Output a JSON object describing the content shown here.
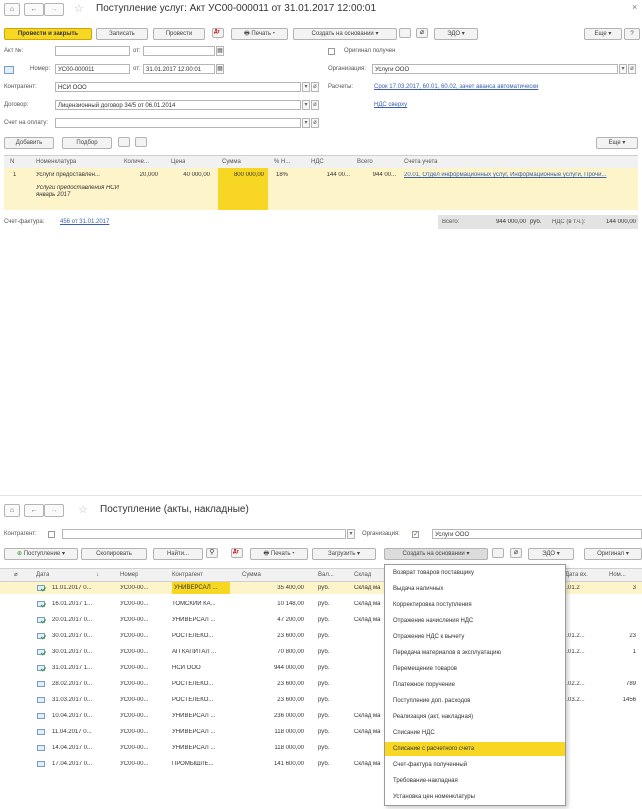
{
  "top": {
    "title": "Поступление услуг: Акт УС00-000011 от 31.01.2017 12:00:01",
    "close": "×",
    "toolbar": {
      "post_close": "Провести и закрыть",
      "save": "Записать",
      "post": "Провести",
      "print": "Печать",
      "create_basis": "Создать на основании",
      "edo": "ЭДО",
      "more": "Еще",
      "help": "?"
    },
    "fields": {
      "act_label": "Акт №:",
      "act_value": "",
      "from1": "от:",
      "date1": ". .",
      "orig_label": "Оригинал получен",
      "number_label": "Номер:",
      "number_value": "УС00-000011",
      "from2": "от:",
      "date2": "31.01.2017 12:00:01",
      "org_label": "Организация:",
      "org_value": "Услуги ООО",
      "counterparty_label": "Контрагент:",
      "counterparty_value": "НСИ ООО",
      "settlements_label": "Расчеты:",
      "settlements_link": "Срок 17.03.2017, 60.01, 60.02, зачет аванса автоматически",
      "contract_label": "Договор:",
      "contract_value": "Лицензионный договор 34/5 от 06.01.2014",
      "vat_link": "НДС сверху",
      "invoice_label": "Счет на оплату:",
      "invoice_value": ""
    },
    "table_toolbar": {
      "add": "Добавить",
      "pick": "Подбор",
      "more": "Еще"
    },
    "columns": [
      "N",
      "Номенклатура",
      "Количе...",
      "Цена",
      "Сумма",
      "% Н...",
      "НДС",
      "Всего",
      "Счета учета"
    ],
    "row": {
      "n": "1",
      "item": "Услуги предоставлен...",
      "item_content": "Услуги предоставления НСИ январь 2017",
      "qty": "20,000",
      "price": "40 000,00",
      "sum": "800 000,00",
      "vat_rate": "18%",
      "vat": "144 00...",
      "total": "944 00...",
      "accounts": "20.01, Отдел информационных услуг, Информационные услуги, Прочи..."
    },
    "footer": {
      "invoice_label": "Счет-фактура:",
      "invoice_link": "456 от 31.01.2017",
      "total_label": "Всего:",
      "total_value": "944 000,00",
      "currency": "руб.",
      "vat_label": "НДС (в т.ч.):",
      "vat_value": "144 000,00"
    }
  },
  "bottom": {
    "title": "Поступление (акты, накладные)",
    "filter": {
      "counterparty_label": "Контрагент:",
      "org_label": "Организация:",
      "org_value": "Услуги ООО"
    },
    "toolbar": {
      "receipt": "Поступление",
      "copy": "Скопировать",
      "find": "Найти...",
      "print": "Печать",
      "load": "Загрузить",
      "create_basis": "Создать на основании",
      "edo": "ЭДО",
      "original": "Оригинал"
    },
    "columns": [
      "Дата",
      "↓",
      "Номер",
      "Контрагент",
      "Сумма",
      "Вал...",
      "Склад",
      "Дата вх.",
      "Ном..."
    ],
    "rows": [
      {
        "date": "11.01.2017 0...",
        "num": "УС00-00...",
        "cp": "УНИВЕРСАЛ ...",
        "sum": "35 400,00",
        "cur": "руб.",
        "wh": "Склад ма",
        "indate": "1.01.2",
        "innum": "3",
        "posted": true
      },
      {
        "date": "16.01.2017 1...",
        "num": "УС00-00...",
        "cp": "ТОМСКИЙ КА...",
        "sum": "10 148,00",
        "cur": "руб.",
        "wh": "Склад ма",
        "indate": "",
        "innum": "",
        "posted": true
      },
      {
        "date": "20.01.2017 0...",
        "num": "УС00-00...",
        "cp": "УНИВЕРСАЛ ...",
        "sum": "47 200,00",
        "cur": "руб.",
        "wh": "Склад ма",
        "indate": "",
        "innum": "",
        "posted": true
      },
      {
        "date": "30.01.2017 0...",
        "num": "УС00-00...",
        "cp": "РОСТЕЛЕКО...",
        "sum": "23 600,00",
        "cur": "руб.",
        "wh": "",
        "indate": "0.01.2...",
        "innum": "23",
        "posted": true
      },
      {
        "date": "30.01.2017 0...",
        "num": "УС00-00...",
        "cp": "АП КАПИТАЛ ...",
        "sum": "70 800,00",
        "cur": "руб.",
        "wh": "",
        "indate": "0.01.2...",
        "innum": "1",
        "posted": true
      },
      {
        "date": "31.01.2017 1...",
        "num": "УС00-00...",
        "cp": "НСИ ООО",
        "sum": "944 000,00",
        "cur": "руб.",
        "wh": "",
        "indate": "",
        "innum": "",
        "posted": true
      },
      {
        "date": "28.02.2017 0...",
        "num": "УС00-00...",
        "cp": "РОСТЕЛЕКО...",
        "sum": "23 600,00",
        "cur": "руб.",
        "wh": "",
        "indate": "8.02.2...",
        "innum": "789",
        "posted": false
      },
      {
        "date": "31.03.2017 0...",
        "num": "УС00-00...",
        "cp": "РОСТЕЛЕКО...",
        "sum": "23 600,00",
        "cur": "руб.",
        "wh": "",
        "indate": "1.03.2...",
        "innum": "1456",
        "posted": false
      },
      {
        "date": "10.04.2017 0...",
        "num": "УС00-00...",
        "cp": "УНИВЕРСАЛ ...",
        "sum": "236 000,00",
        "cur": "руб.",
        "wh": "Склад ма",
        "indate": "",
        "innum": "",
        "posted": false
      },
      {
        "date": "11.04.2017 0...",
        "num": "УС00-00...",
        "cp": "УНИВЕРСАЛ ...",
        "sum": "118 000,00",
        "cur": "руб.",
        "wh": "Склад ма",
        "indate": "",
        "innum": "",
        "posted": false
      },
      {
        "date": "14.04.2017 0...",
        "num": "УС00-00...",
        "cp": "УНИВЕРСАЛ ...",
        "sum": "118 000,00",
        "cur": "руб.",
        "wh": "",
        "indate": "",
        "innum": "",
        "posted": false
      },
      {
        "date": "17.04.2017 0...",
        "num": "УС00-00...",
        "cp": "ПРОМЫШЛЕ...",
        "sum": "141 600,00",
        "cur": "руб.",
        "wh": "Склад ма",
        "indate": "",
        "innum": "",
        "posted": false
      }
    ],
    "menu": [
      "Возврат товаров поставщику",
      "Выдача наличных",
      "Корректировка поступления",
      "Отражение начисления НДС",
      "Отражение НДС к вычету",
      "Передача материалов в эксплуатацию",
      "Перемещение товаров",
      "Платежное поручение",
      "Поступление доп. расходов",
      "Реализация (акт, накладная)",
      "Списание НДС",
      "Списание с расчетного счета",
      "Счет-фактура полученный",
      "Требование-накладная",
      "Установка цен номенклатуры"
    ],
    "menu_selected": 11
  },
  "colors": {
    "accent": "#f7d724",
    "link": "#3a5fb0",
    "posted": "#2a9b2a"
  },
  "icons": [
    "home-icon",
    "back-icon",
    "forward-icon",
    "star-icon",
    "printer-icon",
    "search-icon",
    "paperclip-icon",
    "report-icon",
    "dt-kt-icon",
    "calendar-icon",
    "open-icon",
    "dropdown-icon",
    "check-icon",
    "document-icon"
  ]
}
